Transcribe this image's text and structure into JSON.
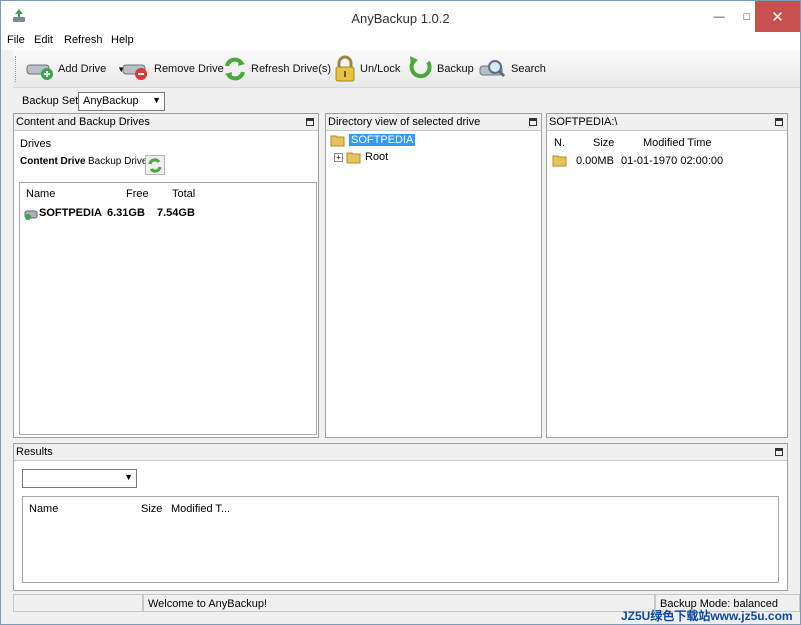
{
  "window": {
    "title": "AnyBackup 1.0.2"
  },
  "menu": [
    "File",
    "Edit",
    "Refresh",
    "Help"
  ],
  "toolbar": {
    "add_drive": "Add Drive",
    "remove_drive": "Remove Drive",
    "refresh_drives": "Refresh Drive(s)",
    "unlock": "Un/Lock",
    "backup": "Backup",
    "search": "Search"
  },
  "backup_set": {
    "label": "Backup Set:",
    "value": "AnyBackup"
  },
  "left_panel": {
    "title": "Content and Backup Drives",
    "drives_label": "Drives",
    "tab_content": "Content Drive",
    "tab_backup": "Backup Drive",
    "columns": [
      "Name",
      "Free",
      "Total"
    ],
    "rows": [
      {
        "name": "SOFTPEDIA",
        "free": "6.31GB",
        "total": "7.54GB"
      }
    ]
  },
  "middle_panel": {
    "title": "Directory view of selected drive",
    "root_label": "SOFTPEDIA",
    "child_label": "Root"
  },
  "right_panel": {
    "title": "SOFTPEDIA:\\",
    "columns": [
      "N.",
      "Size",
      "Modified Time"
    ],
    "rows": [
      {
        "size": "0.00MB",
        "modified": "01-01-1970 02:00:00"
      }
    ]
  },
  "results_panel": {
    "title": "Results",
    "columns": [
      "Name",
      "Size",
      "Modified T..."
    ]
  },
  "status": {
    "message": "Welcome to AnyBackup!",
    "mode": "Backup Mode: balanced"
  },
  "watermark": "JZ5U绿色下载站www.jz5u.com",
  "colors": {
    "selection": "#3399ff",
    "close_button": "#c75050"
  }
}
